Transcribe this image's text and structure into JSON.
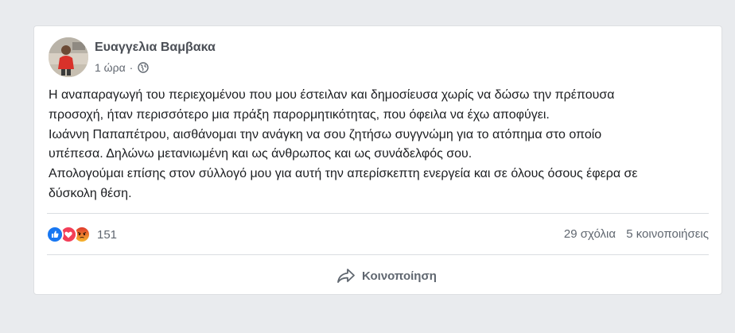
{
  "post": {
    "author": "Ευαγγελια Βαμβακα",
    "time": "1 ώρα",
    "separator": "·",
    "privacy_icon": "globe-icon",
    "body_lines": [
      "Η αναπαραγωγή του περιεχομένου που μου έστειλαν και δημοσίευσα χωρίς να δώσω την πρέπουσα",
      "προσοχή, ήταν περισσότερο μια πράξη παρορμητικότητας, που όφειλα να έχω αποφύγει.",
      "Ιωάννη Παπαπέτρου, αισθάνομαι την ανάγκη να σου ζητήσω συγγνώμη για το ατόπημα στο οποίο",
      "υπέπεσα. Δηλώνω μετανιωμένη και ως άνθρωπος και ως συνάδελφός σου.",
      "Απολογούμαι επίσης στον σύλλογό μου για αυτή την απερίσκεπτη ενεργεία και σε όλους όσους έφερα σε",
      "δύσκολη θέση."
    ]
  },
  "reactions": {
    "icons": [
      "like-icon",
      "love-icon",
      "angry-icon"
    ],
    "count": "151"
  },
  "stats": {
    "comments": "29 σχόλια",
    "shares": "5 κοινοποιήσεις"
  },
  "actions": {
    "share_label": "Κοινοποίηση",
    "share_icon": "share-arrow-icon"
  },
  "colors": {
    "like": "#1877f2",
    "love": "#f33e58",
    "angry": "#e9710f",
    "background": "#e9ebee"
  }
}
